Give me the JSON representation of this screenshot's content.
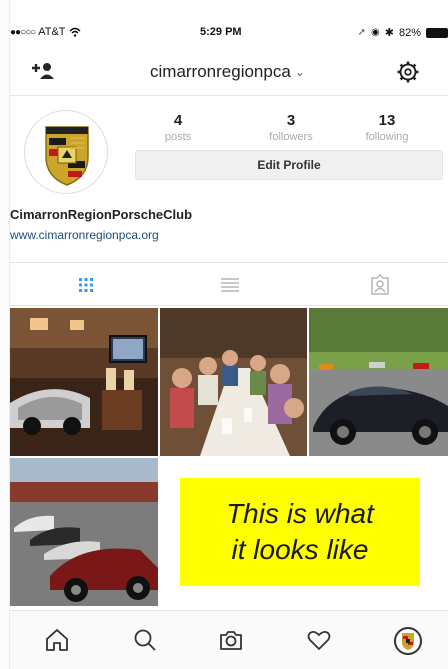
{
  "status_bar": {
    "carrier": "AT&T",
    "time": "5:29 PM",
    "battery": "82%"
  },
  "header": {
    "username": "cimarronregionpca",
    "dropdown_glyph": "⌄"
  },
  "profile": {
    "stats": [
      {
        "value": "4",
        "label": "posts"
      },
      {
        "value": "3",
        "label": "followers"
      },
      {
        "value": "13",
        "label": "following"
      }
    ],
    "edit_button_label": "Edit Profile",
    "display_name": "CimarronRegionPorscheClub",
    "website": "www.cimarronregionpca.org"
  },
  "tabs": [
    {
      "name": "grid-view",
      "icon": "grid-icon",
      "active": true
    },
    {
      "name": "list-view",
      "icon": "list-icon",
      "active": false
    },
    {
      "name": "tagged-view",
      "icon": "tagged-person-icon",
      "active": false
    }
  ],
  "posts": [
    {
      "name": "post-garage-interior"
    },
    {
      "name": "post-club-dinner"
    },
    {
      "name": "post-black-porsche"
    },
    {
      "name": "post-porsche-lineup"
    }
  ],
  "caption": {
    "line1": "This is what",
    "line2": "it looks like"
  },
  "bottom_nav": [
    {
      "name": "home",
      "icon": "home-icon"
    },
    {
      "name": "search",
      "icon": "search-icon"
    },
    {
      "name": "camera",
      "icon": "camera-icon"
    },
    {
      "name": "activity",
      "icon": "heart-icon"
    },
    {
      "name": "profile",
      "icon": "porsche-crest-icon"
    }
  ],
  "colors": {
    "accent_blue": "#3897f0",
    "link": "#1e4c7c",
    "caption_background": "#ffff00",
    "muted_label": "#aaaaaa"
  }
}
